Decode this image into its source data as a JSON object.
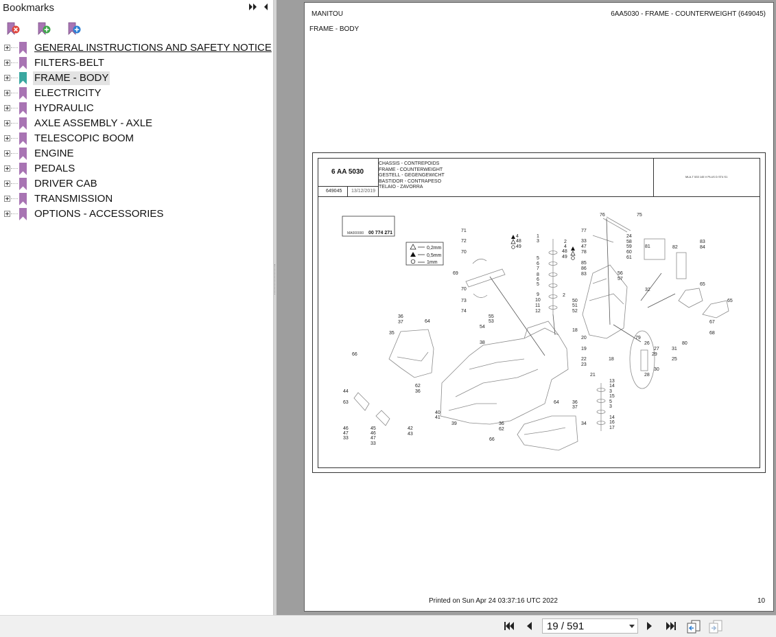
{
  "bookmarks_panel": {
    "title": "Bookmarks",
    "items": [
      {
        "label": "GENERAL INSTRUCTIONS AND SAFETY NOTICE"
      },
      {
        "label": "FILTERS-BELT"
      },
      {
        "label": "FRAME - BODY"
      },
      {
        "label": "ELECTRICITY"
      },
      {
        "label": "HYDRAULIC"
      },
      {
        "label": "AXLE ASSEMBLY - AXLE"
      },
      {
        "label": "TELESCOPIC BOOM"
      },
      {
        "label": "ENGINE"
      },
      {
        "label": "PEDALS"
      },
      {
        "label": "DRIVER CAB"
      },
      {
        "label": "TRANSMISSION"
      },
      {
        "label": "OPTIONS - ACCESSORIES"
      }
    ],
    "selected_index": 2,
    "colors": {
      "flag": "#a874b3",
      "flag_selected": "#3aa7a0"
    }
  },
  "document": {
    "header_left": "MANITOU",
    "header_right": "6AA5030 - FRAME - COUNTERWEIGHT (649045)",
    "section": "FRAME - BODY",
    "drawing": {
      "code": "6 AA 5030",
      "ref": "649045",
      "date": "13/12/2019",
      "titles": [
        "CHASSIS - CONTREPOIDS",
        "FRAME - COUNTERWEIGHT",
        "GESTELL - GEGENGEWICHT",
        "BASTIDOR - CONTRAPESO",
        "TELAIO - ZAVORRA"
      ],
      "model": "MLA-T 533 145 V PLUS D ST4 S1",
      "legend": [
        "0,2mm",
        "0,5mm",
        "1mm"
      ],
      "label_number": "00 774 271",
      "label_code": "MA000000"
    },
    "footer_printed": "Printed on  Sun Apr 24 03:37:16 UTC 2022",
    "page_number": "10"
  },
  "navigation": {
    "page_display": "19 / 591"
  }
}
